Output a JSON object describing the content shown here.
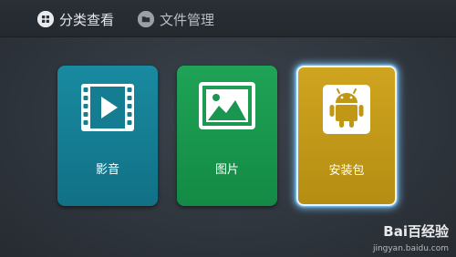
{
  "topbar": {
    "tabs": [
      {
        "label": "分类查看",
        "icon": "grid-icon",
        "active": true
      },
      {
        "label": "文件管理",
        "icon": "folder-icon",
        "active": false
      }
    ]
  },
  "tiles": [
    {
      "label": "影音",
      "icon": "video-play-icon",
      "color": "#178ba1"
    },
    {
      "label": "图片",
      "icon": "picture-icon",
      "color": "#1c9c50"
    },
    {
      "label": "安装包",
      "icon": "android-icon",
      "color": "#c59b18",
      "selected": true
    }
  ],
  "watermark": {
    "brand": "Bai百经验",
    "url": "jingyan.baidu.com"
  }
}
